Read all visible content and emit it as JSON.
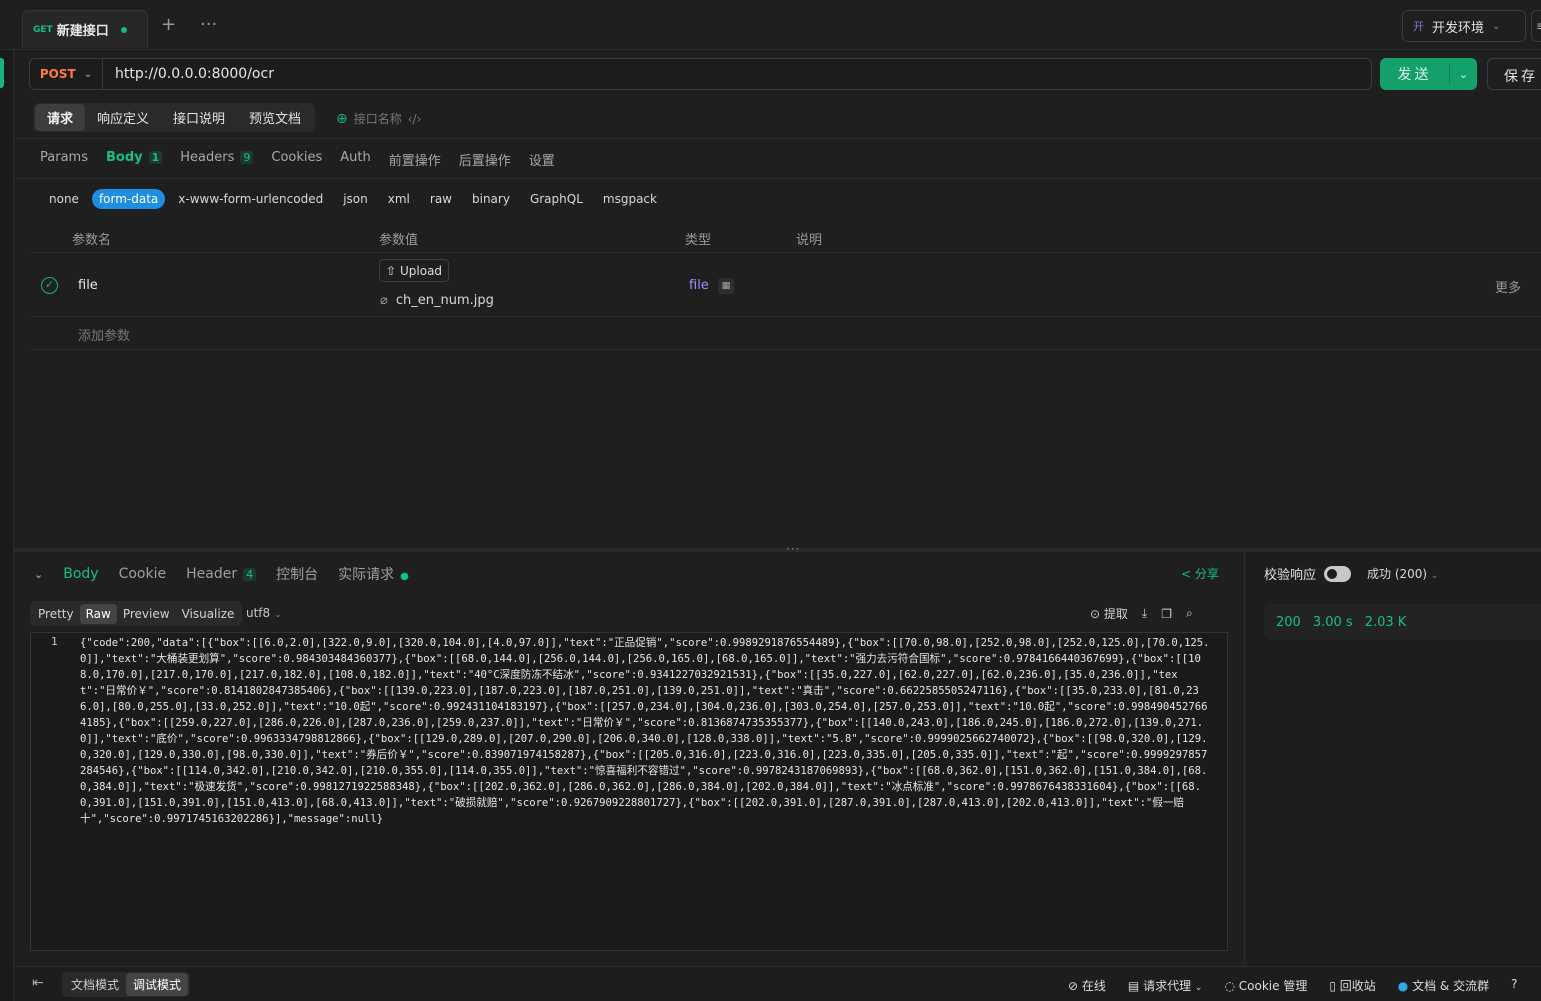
{
  "tab": {
    "method": "GET",
    "title": "新建接口"
  },
  "env": {
    "badge": "开",
    "name": "开发环境"
  },
  "request": {
    "method": "POST",
    "url": "http://0.0.0.0:8000/ocr",
    "send_label": "发送",
    "save_label": "保存"
  },
  "mode_tabs": [
    "请求",
    "响应定义",
    "接口说明",
    "预览文档"
  ],
  "api_name_placeholder": "接口名称",
  "req_tabs": [
    {
      "label": "Params"
    },
    {
      "label": "Body",
      "count": "1"
    },
    {
      "label": "Headers",
      "count": "9"
    },
    {
      "label": "Cookies"
    },
    {
      "label": "Auth"
    },
    {
      "label": "前置操作"
    },
    {
      "label": "后置操作"
    },
    {
      "label": "设置"
    }
  ],
  "body_types": [
    "none",
    "form-data",
    "x-www-form-urlencoded",
    "json",
    "xml",
    "raw",
    "binary",
    "GraphQL",
    "msgpack"
  ],
  "params_header": {
    "name": "参数名",
    "value": "参数值",
    "type": "类型",
    "desc": "说明"
  },
  "param": {
    "name": "file",
    "upload_label": "Upload",
    "file_name": "ch_en_num.jpg",
    "type": "file",
    "more": "更多"
  },
  "add_param": "添加参数",
  "response": {
    "tabs": [
      {
        "label": "Body"
      },
      {
        "label": "Cookie"
      },
      {
        "label": "Header",
        "count": "4"
      },
      {
        "label": "控制台"
      },
      {
        "label": "实际请求"
      }
    ],
    "share": "分享",
    "formats": [
      "Pretty",
      "Raw",
      "Preview",
      "Visualize"
    ],
    "encoding": "utf8",
    "extract": "提取",
    "line_no": "1",
    "body": "{\"code\":200,\"data\":[{\"box\":[[6.0,2.0],[322.0,9.0],[320.0,104.0],[4.0,97.0]],\"text\":\"正品促销\",\"score\":0.9989291876554489},{\"box\":[[70.0,98.0],[252.0,98.0],[252.0,125.0],[70.0,125.0]],\"text\":\"大桶装更划算\",\"score\":0.984303484360377},{\"box\":[[68.0,144.0],[256.0,144.0],[256.0,165.0],[68.0,165.0]],\"text\":\"强力去污符合国标\",\"score\":0.9784166440367699},{\"box\":[[108.0,170.0],[217.0,170.0],[217.0,182.0],[108.0,182.0]],\"text\":\"40°C深度防冻不结冰\",\"score\":0.9341227032921531},{\"box\":[[35.0,227.0],[62.0,227.0],[62.0,236.0],[35.0,236.0]],\"text\":\"日常价￥\",\"score\":0.8141802847385406},{\"box\":[[139.0,223.0],[187.0,223.0],[187.0,251.0],[139.0,251.0]],\"text\":\"真击\",\"score\":0.6622585505247116},{\"box\":[[35.0,233.0],[81.0,236.0],[80.0,255.0],[33.0,252.0]],\"text\":\"10.0起\",\"score\":0.992431104183197},{\"box\":[[257.0,234.0],[304.0,236.0],[303.0,254.0],[257.0,253.0]],\"text\":\"10.0起\",\"score\":0.9984904527664185},{\"box\":[[259.0,227.0],[286.0,226.0],[287.0,236.0],[259.0,237.0]],\"text\":\"日常价￥\",\"score\":0.8136874735355377},{\"box\":[[140.0,243.0],[186.0,245.0],[186.0,272.0],[139.0,271.0]],\"text\":\"底价\",\"score\":0.9963334798812866},{\"box\":[[129.0,289.0],[207.0,290.0],[206.0,340.0],[128.0,338.0]],\"text\":\"5.8\",\"score\":0.9999025662740072},{\"box\":[[98.0,320.0],[129.0,320.0],[129.0,330.0],[98.0,330.0]],\"text\":\"券后价￥\",\"score\":0.839071974158287},{\"box\":[[205.0,316.0],[223.0,316.0],[223.0,335.0],[205.0,335.0]],\"text\":\"起\",\"score\":0.9999297857284546},{\"box\":[[114.0,342.0],[210.0,342.0],[210.0,355.0],[114.0,355.0]],\"text\":\"惊喜福利不容错过\",\"score\":0.9978243187069893},{\"box\":[[68.0,362.0],[151.0,362.0],[151.0,384.0],[68.0,384.0]],\"text\":\"极速发货\",\"score\":0.9981271922588348},{\"box\":[[202.0,362.0],[286.0,362.0],[286.0,384.0],[202.0,384.0]],\"text\":\"冰点标准\",\"score\":0.9978676438331604},{\"box\":[[68.0,391.0],[151.0,391.0],[151.0,413.0],[68.0,413.0]],\"text\":\"破损就赔\",\"score\":0.9267909228801727},{\"box\":[[202.0,391.0],[287.0,391.0],[287.0,413.0],[202.0,413.0]],\"text\":\"假一赔十\",\"score\":0.9971745163202286}],\"message\":null}"
  },
  "validate": {
    "label": "校验响应",
    "state": "成功 (200)"
  },
  "status": {
    "code": "200",
    "time": "3.00 s",
    "size": "2.03 K"
  },
  "footer": {
    "modes": [
      "文档模式",
      "调试模式"
    ],
    "items": [
      "在线",
      "请求代理",
      "Cookie 管理",
      "回收站",
      "文档 & 交流群"
    ]
  }
}
